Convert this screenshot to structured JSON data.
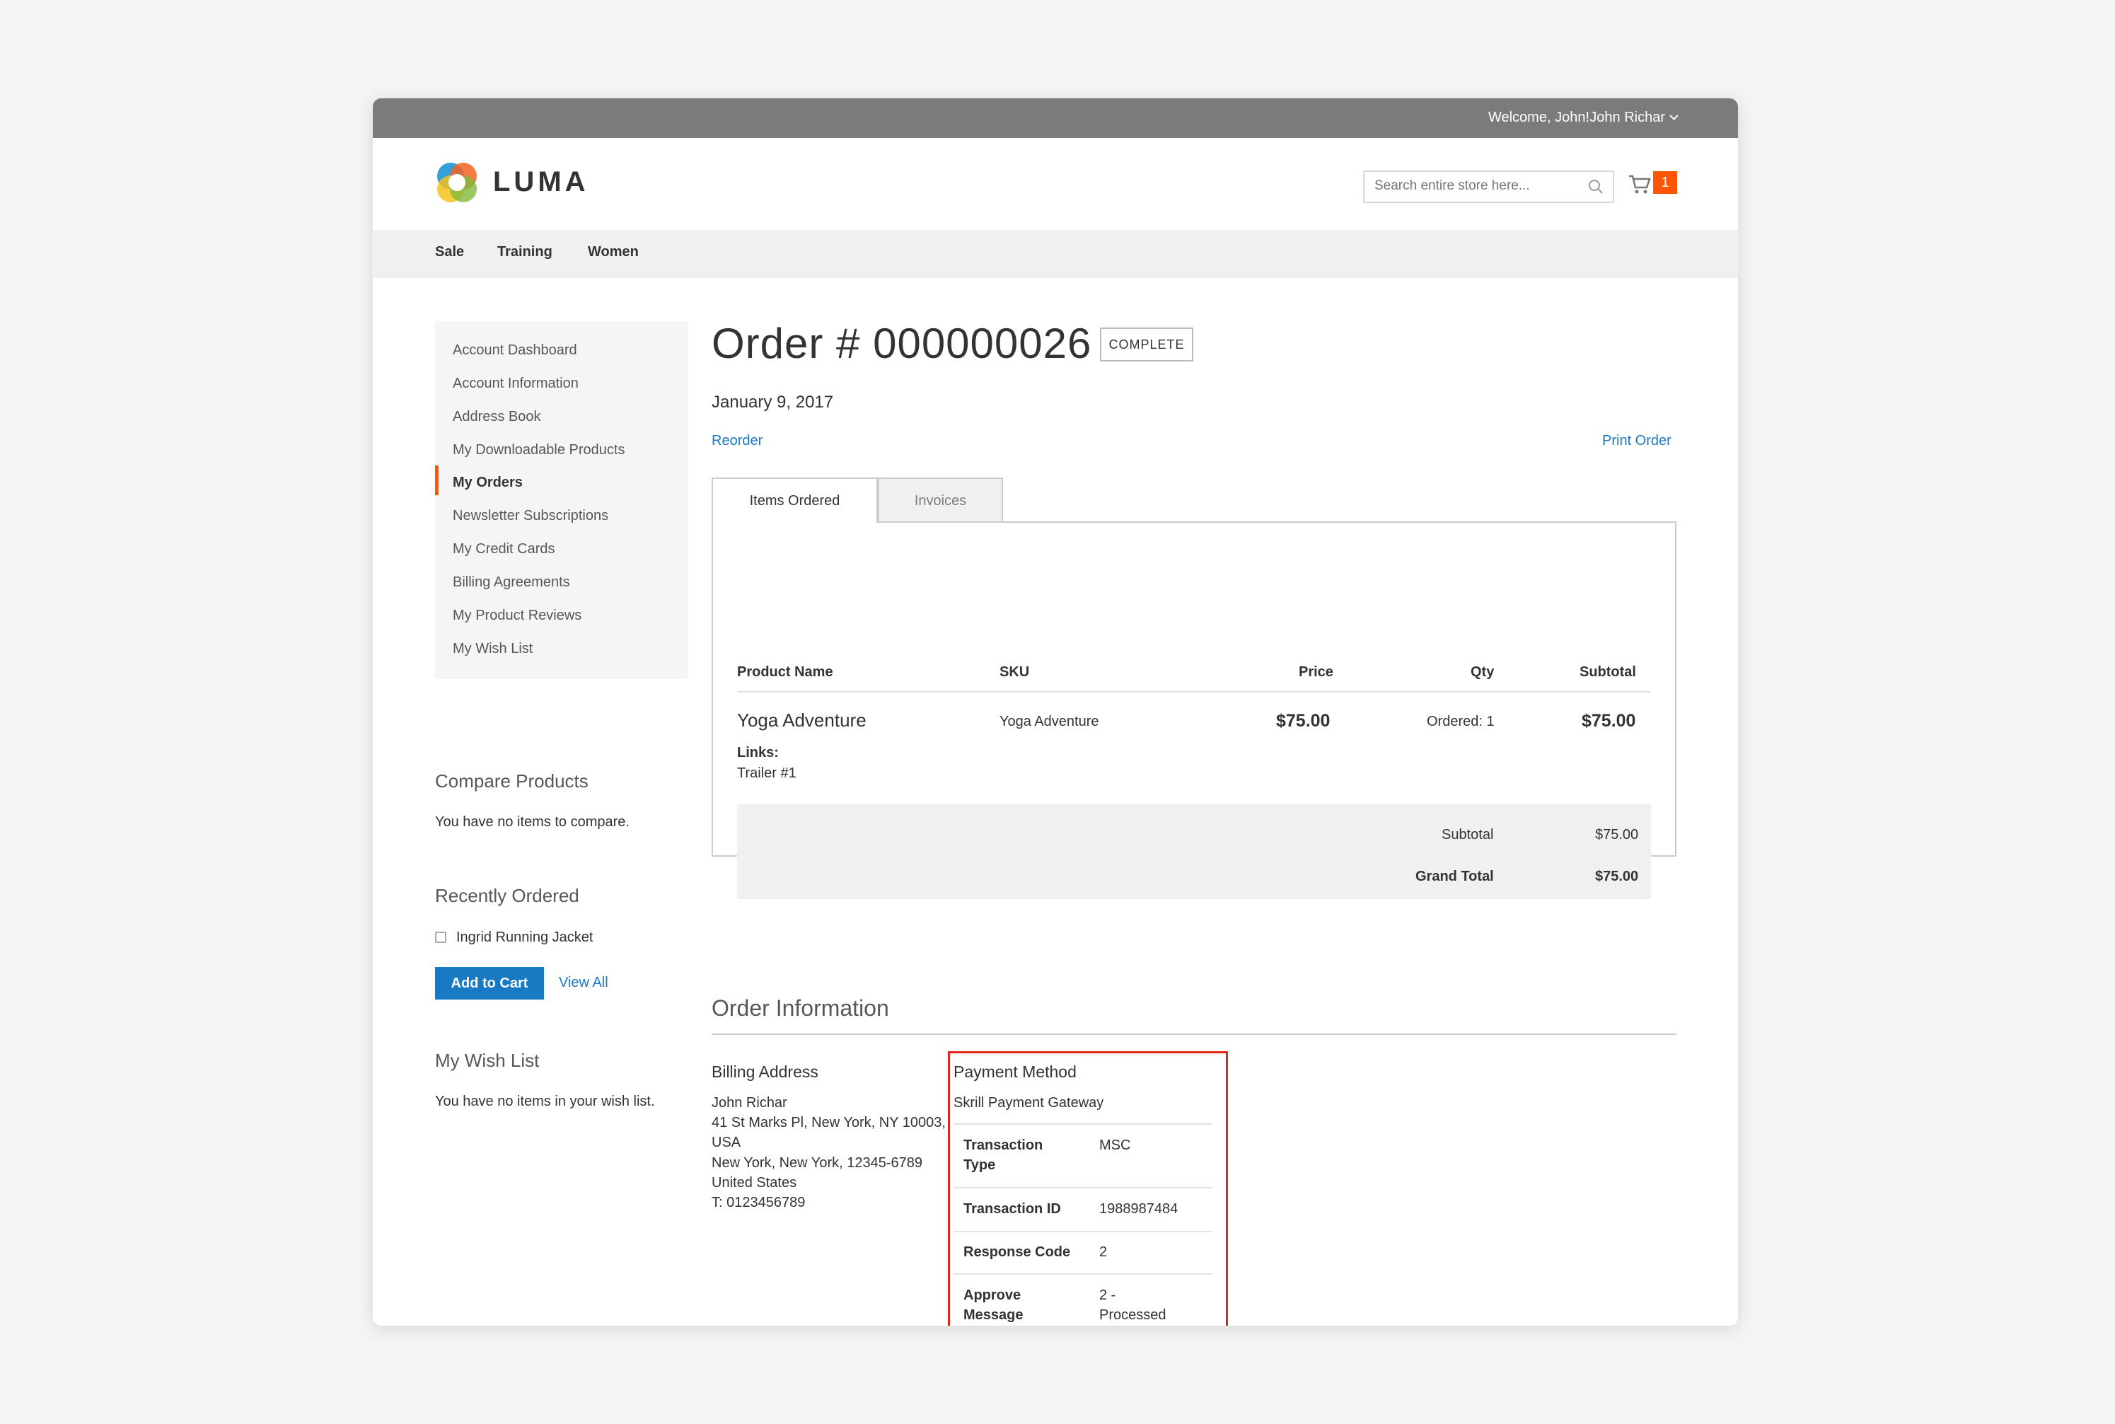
{
  "topbar": {
    "welcome": "Welcome, John!",
    "user_name": "John Richar"
  },
  "header": {
    "logo_text": "LUMA",
    "search_placeholder": "Search entire store here...",
    "cart_count": "1"
  },
  "nav": [
    "Sale",
    "Training",
    "Women"
  ],
  "sidebar": {
    "items": [
      "Account Dashboard",
      "Account Information",
      "Address Book",
      "My Downloadable Products",
      "My Orders",
      "Newsletter Subscriptions",
      "My Credit Cards",
      "Billing Agreements",
      "My Product Reviews",
      "My Wish List"
    ],
    "active_index": 4
  },
  "compare": {
    "title": "Compare Products",
    "text": "You have no items to compare."
  },
  "recently_ordered": {
    "title": "Recently Ordered",
    "item": "Ingrid Running Jacket",
    "add_to_cart": "Add to Cart",
    "view_all": "View All"
  },
  "wishlist": {
    "title": "My Wish List",
    "text": "You have no items in your wish list."
  },
  "order": {
    "title": "Order # 000000026",
    "status": "COMPLETE",
    "date": "January 9, 2017",
    "reorder": "Reorder",
    "print": "Print Order"
  },
  "tabs": [
    "Items Ordered",
    "Invoices"
  ],
  "table": {
    "headers": [
      "Product Name",
      "SKU",
      "Price",
      "Qty",
      "Subtotal"
    ],
    "row": {
      "name": "Yoga Adventure",
      "sku": "Yoga Adventure",
      "price": "$75.00",
      "qty": "Ordered: 1",
      "subtotal": "$75.00",
      "links_label": "Links:",
      "link": "Trailer #1"
    },
    "totals": [
      {
        "label": "Subtotal",
        "value": "$75.00"
      },
      {
        "label": "Grand Total",
        "value": "$75.00"
      }
    ]
  },
  "order_info": {
    "title": "Order Information",
    "billing": {
      "title": "Billing Address",
      "lines": [
        "John Richar",
        "41 St Marks Pl, New York, NY 10003,",
        "USA",
        "New York, New York, 12345-6789",
        "United States",
        "T: 0123456789"
      ]
    },
    "payment": {
      "title": "Payment Method",
      "method": "Skrill Payment Gateway",
      "rows": [
        {
          "label": [
            "Transaction",
            "Type"
          ],
          "value": [
            "MSC"
          ]
        },
        {
          "label": [
            "Transaction ID"
          ],
          "value": [
            "1988987484"
          ]
        },
        {
          "label": [
            "Response Code"
          ],
          "value": [
            "2"
          ]
        },
        {
          "label": [
            "Approve",
            "Message"
          ],
          "value": [
            "2 -",
            "Processed"
          ]
        }
      ]
    }
  },
  "colors": {
    "accent": "#ff5501",
    "link": "#1979c3",
    "highlight": "#e1251b",
    "topbar": "#7b7b7a"
  }
}
